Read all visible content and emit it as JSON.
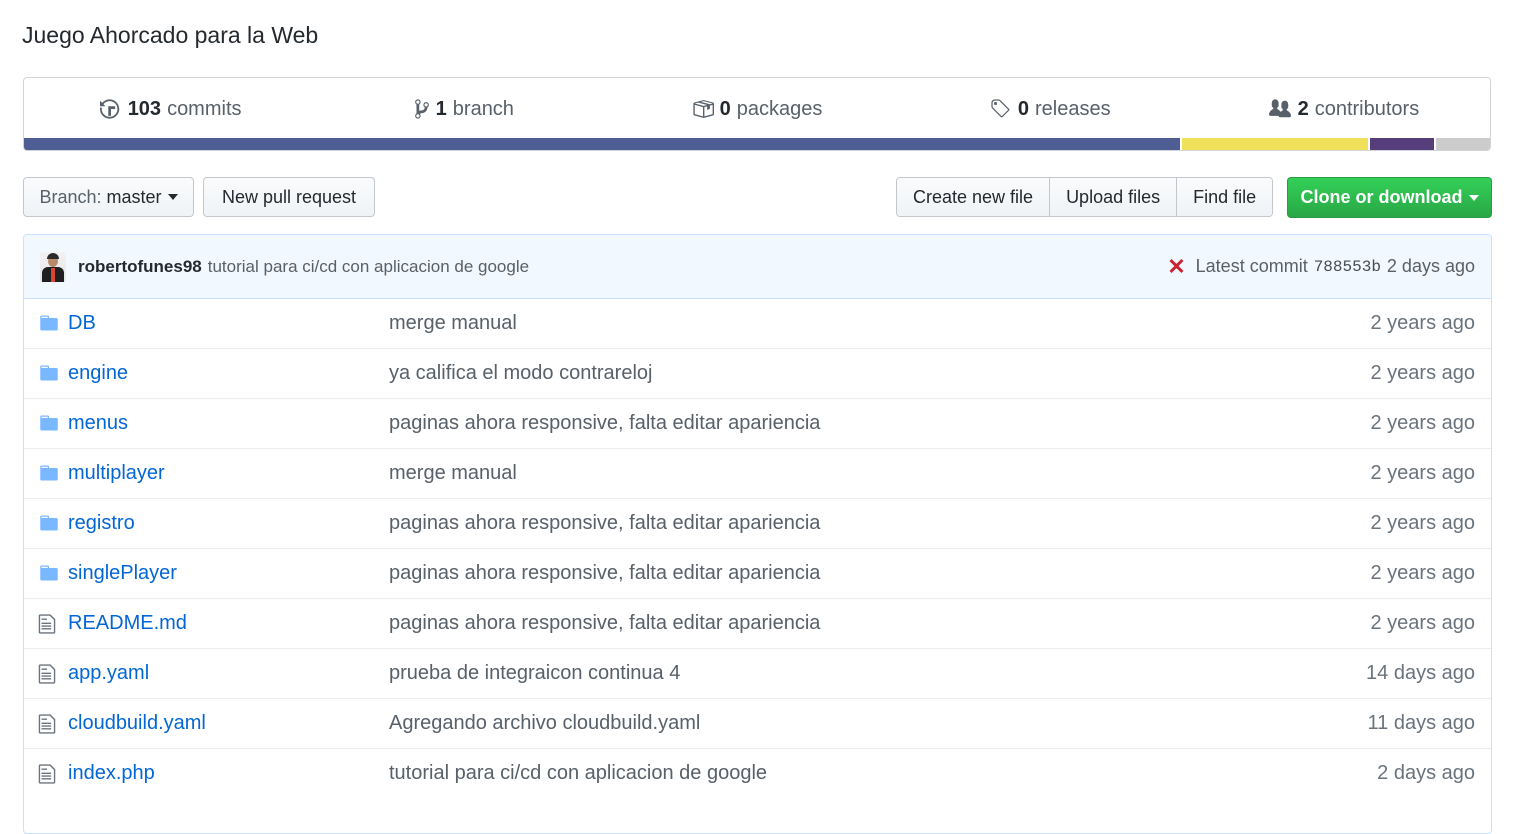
{
  "repo": {
    "description": "Juego Ahorcado para la Web"
  },
  "summary": {
    "commits_count": "103",
    "commits_label": "commits",
    "branch_count": "1",
    "branch_label": "branch",
    "packages_count": "0",
    "packages_label": "packages",
    "releases_count": "0",
    "releases_label": "releases",
    "contributors_count": "2",
    "contributors_label": "contributors",
    "icons": [
      "history-icon",
      "git-branch-icon",
      "package-icon",
      "tag-icon",
      "people-icon"
    ]
  },
  "language_bar": [
    {
      "color": "#4f5d95",
      "percent": 79.2
    },
    {
      "color": "#f1e05a",
      "percent": 12.7
    },
    {
      "color": "#563d7c",
      "percent": 4.4
    },
    {
      "color": "#cccccc",
      "percent": 3.7
    }
  ],
  "toolbar": {
    "branch_prefix": "Branch:",
    "branch_name": "master",
    "new_pull_request": "New pull request",
    "create_new_file": "Create new file",
    "upload_files": "Upload files",
    "find_file": "Find file",
    "clone_or_download": "Clone or download"
  },
  "latest_commit": {
    "author": "robertofunes98",
    "message": "tutorial para ci/cd con aplicacion de google",
    "status_icon": "x-icon",
    "status_color": "#cb2431",
    "label": "Latest commit",
    "sha": "788553b",
    "age": "2 days ago"
  },
  "files": [
    {
      "type": "folder",
      "name": "DB",
      "message": "merge manual",
      "age": "2 years ago"
    },
    {
      "type": "folder",
      "name": "engine",
      "message": "ya califica el modo contrareloj",
      "age": "2 years ago"
    },
    {
      "type": "folder",
      "name": "menus",
      "message": "paginas ahora responsive, falta editar apariencia",
      "age": "2 years ago"
    },
    {
      "type": "folder",
      "name": "multiplayer",
      "message": "merge manual",
      "age": "2 years ago"
    },
    {
      "type": "folder",
      "name": "registro",
      "message": "paginas ahora responsive, falta editar apariencia",
      "age": "2 years ago"
    },
    {
      "type": "folder",
      "name": "singlePlayer",
      "message": "paginas ahora responsive, falta editar apariencia",
      "age": "2 years ago"
    },
    {
      "type": "file",
      "name": "README.md",
      "message": "paginas ahora responsive, falta editar apariencia",
      "age": "2 years ago"
    },
    {
      "type": "file",
      "name": "app.yaml",
      "message": "prueba de integraicon continua 4",
      "age": "14 days ago"
    },
    {
      "type": "file",
      "name": "cloudbuild.yaml",
      "message": "Agregando archivo cloudbuild.yaml",
      "age": "11 days ago"
    },
    {
      "type": "file",
      "name": "index.php",
      "message": "tutorial para ci/cd con aplicacion de google",
      "age": "2 days ago"
    }
  ],
  "colors": {
    "link": "#0366d6",
    "folder_icon": "#79b8ff",
    "clone_green": "#28a745"
  }
}
